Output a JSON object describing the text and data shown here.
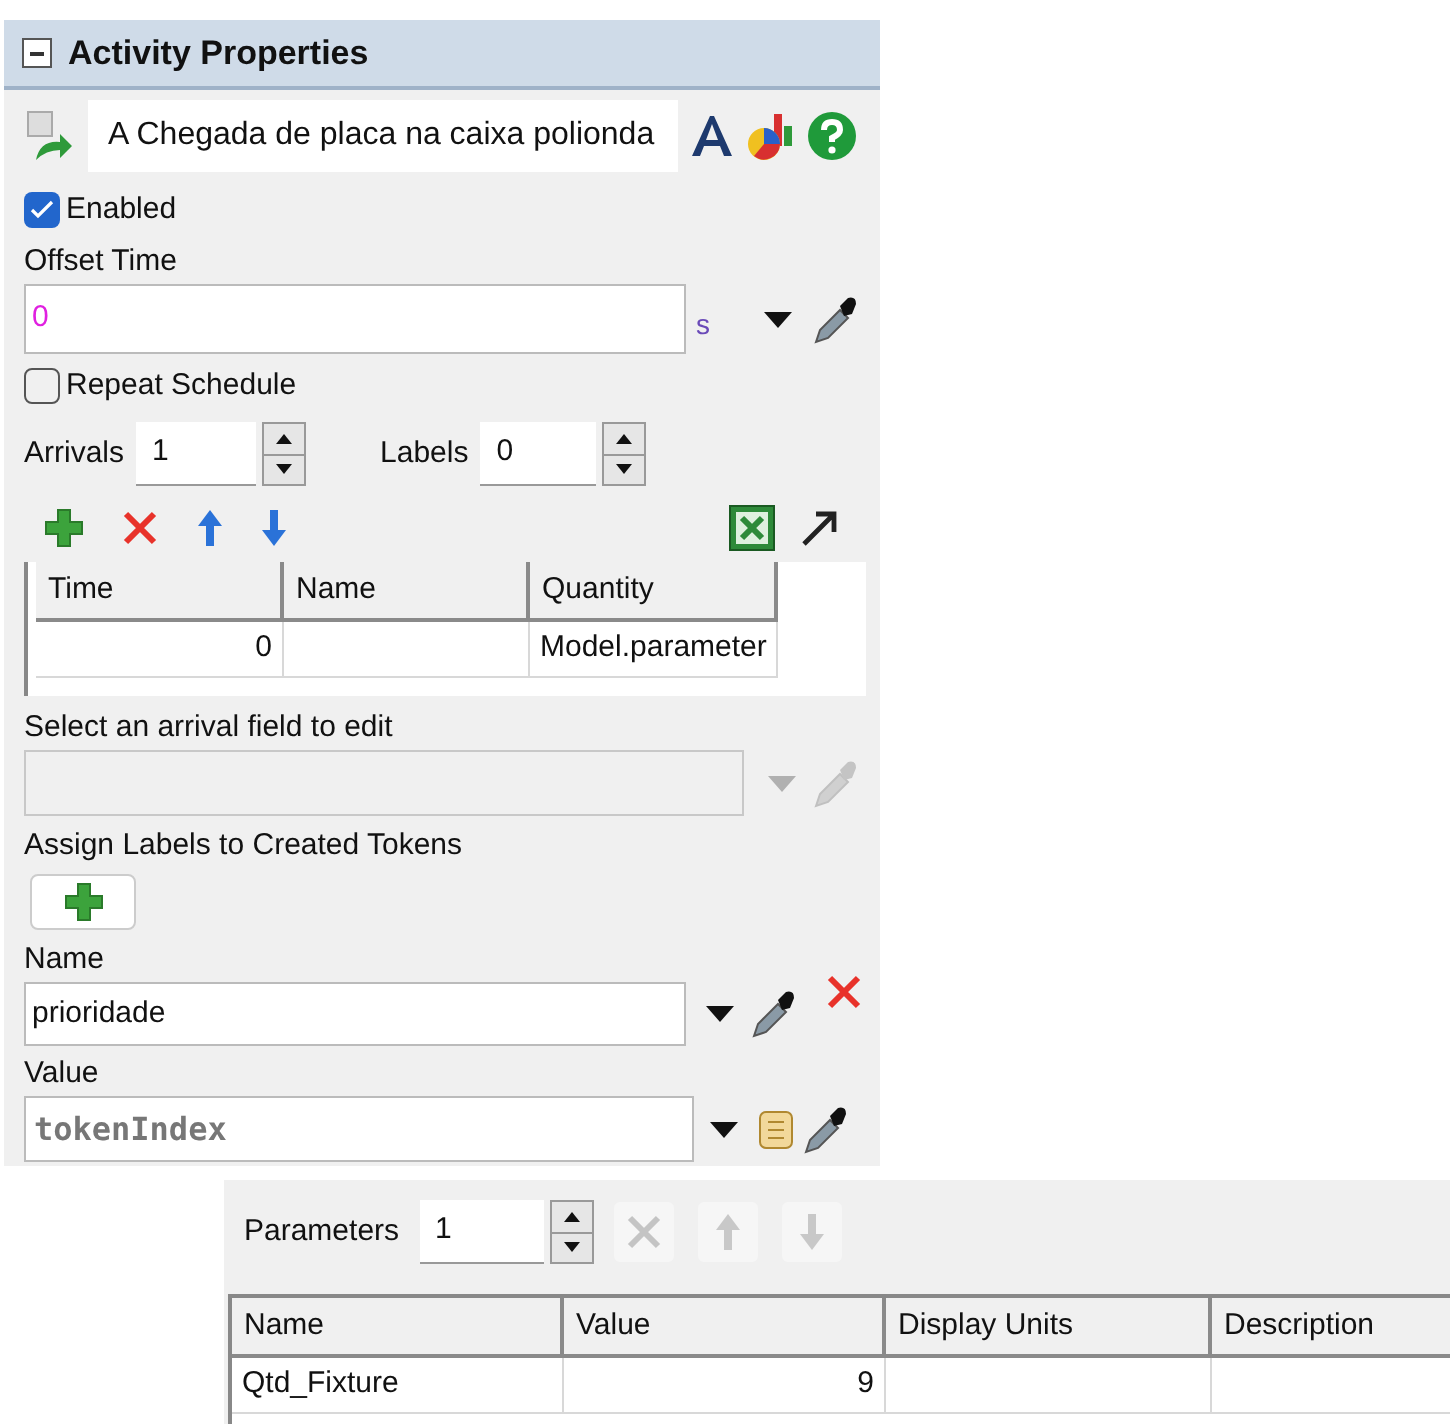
{
  "activity_properties": {
    "title": "Activity Properties",
    "activity_name": "A Chegada de placa na caixa polionda",
    "enabled": {
      "label": "Enabled",
      "checked": true
    },
    "offset_time": {
      "label": "Offset Time",
      "value": "0",
      "unit": "s"
    },
    "repeat_schedule": {
      "label": "Repeat Schedule",
      "checked": false
    },
    "arrivals": {
      "label": "Arrivals",
      "value": "1"
    },
    "labels": {
      "label": "Labels",
      "value": "0"
    },
    "arrival_table": {
      "columns": [
        "Time",
        "Name",
        "Quantity"
      ],
      "rows": [
        [
          "0",
          null,
          "Model.parameter"
        ]
      ]
    },
    "arrival_field": {
      "label": "Select an arrival field to edit",
      "disabled": true
    },
    "assign_labels": {
      "label": "Assign Labels to Created Tokens"
    },
    "label_name": {
      "label": "Name",
      "value": "prioridade"
    },
    "label_value": {
      "label": "Value",
      "value": "tokenIndex"
    }
  },
  "parameters": {
    "label": "Parameters",
    "value": "1",
    "buttons": [
      {
        "kind": "delete",
        "disabled": true
      },
      {
        "kind": "up",
        "disabled": true
      },
      {
        "kind": "down",
        "disabled": true
      }
    ],
    "columns": [
      "Name",
      "Value",
      "Display Units",
      "Description"
    ],
    "rows": [
      [
        "Qtd_Fixture",
        "9",
        null,
        null
      ]
    ]
  }
}
